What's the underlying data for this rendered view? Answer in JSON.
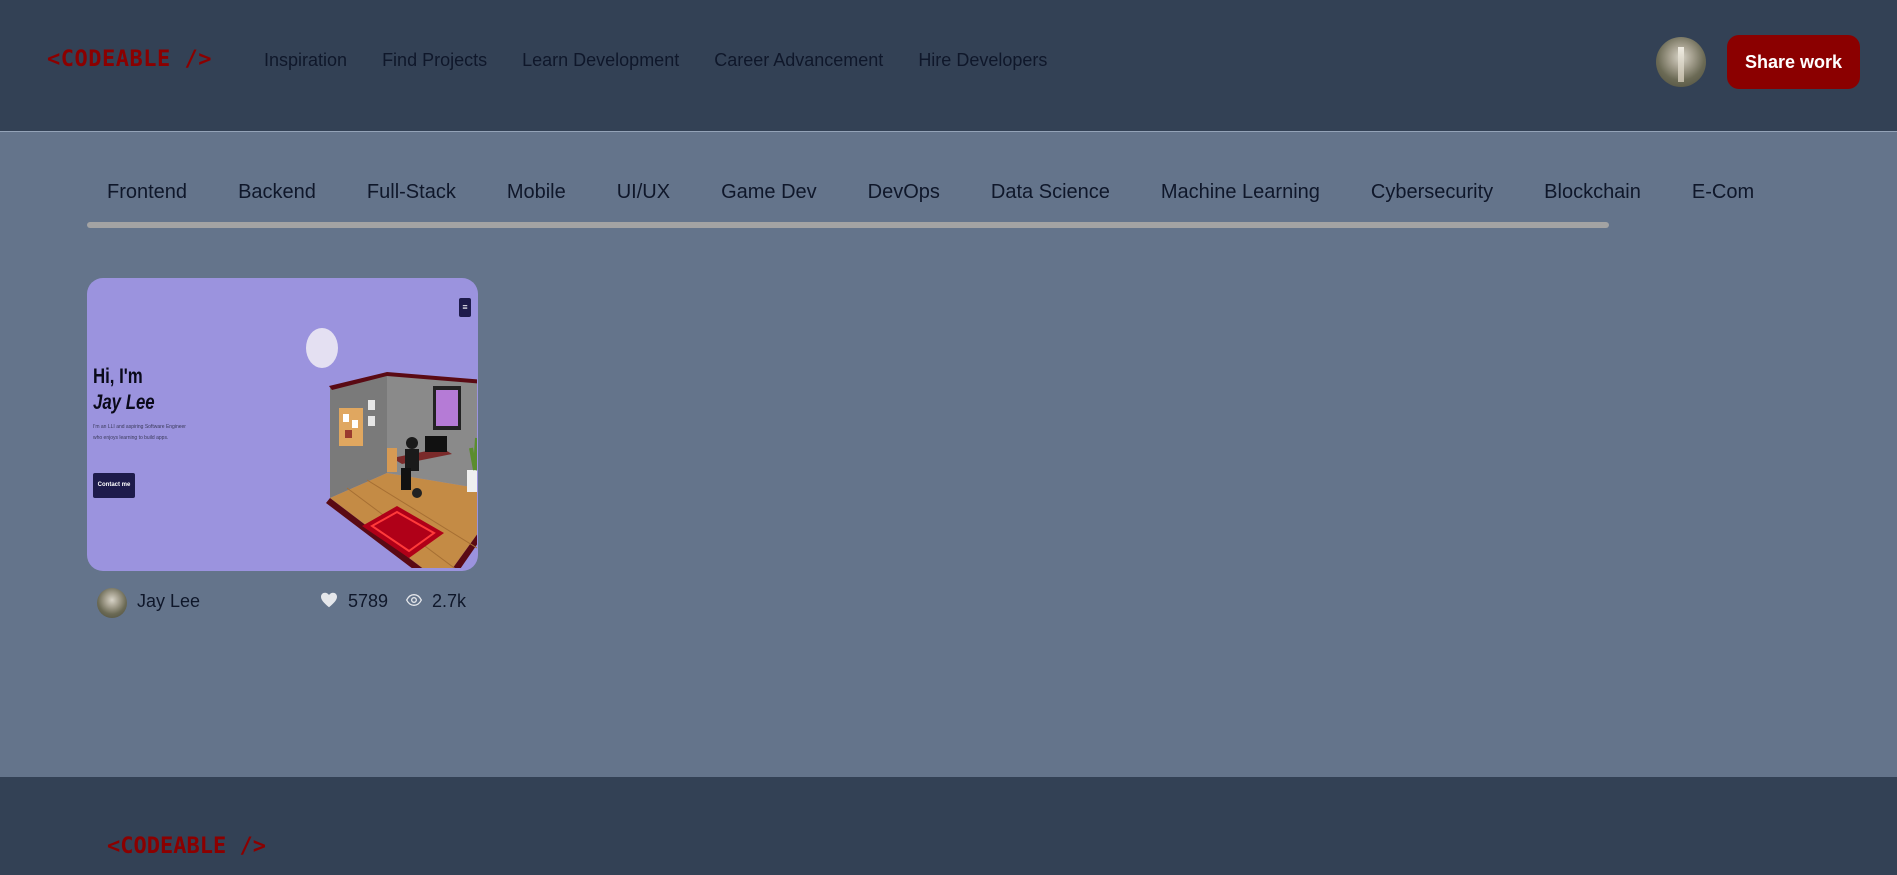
{
  "header": {
    "logo": "<CODEABLE />",
    "nav": [
      "Inspiration",
      "Find Projects",
      "Learn Development",
      "Career Advancement",
      "Hire Developers"
    ],
    "share_label": "Share work"
  },
  "categories": [
    "Frontend",
    "Backend",
    "Full-Stack",
    "Mobile",
    "UI/UX",
    "Game Dev",
    "DevOps",
    "Data Science",
    "Machine Learning",
    "Cybersecurity",
    "Blockchain",
    "E-Com"
  ],
  "project": {
    "preview": {
      "greeting": "Hi, I'm",
      "name": "Jay Lee",
      "description": "I'm an LLI and aspiring Software Engineer who enjoys learning to build apps.",
      "contact_label": "Contact me",
      "menu_glyph": "≡"
    },
    "author": "Jay Lee",
    "likes": "5789",
    "views": "2.7k"
  },
  "footer": {
    "logo": "<CODEABLE />"
  },
  "colors": {
    "header_bg": "#334155",
    "page_bg": "#64748b",
    "brand": "#8b0000",
    "card_bg": "#9b93de"
  }
}
